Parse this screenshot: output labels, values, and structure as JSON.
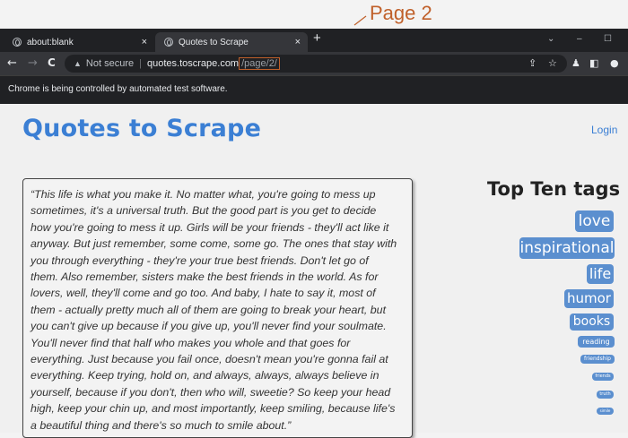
{
  "annotation": {
    "text": "Page 2",
    "color": "#c0602a"
  },
  "browser": {
    "tabs": [
      {
        "label": "about:blank",
        "close": "×"
      },
      {
        "label": "Quotes to Scrape",
        "close": "×"
      }
    ],
    "new_tab": "+",
    "window_controls": {
      "dropdown": "⌄",
      "minimize": "–",
      "maximize": "☐"
    },
    "nav": {
      "back": "←",
      "forward": "→",
      "reload": "C"
    },
    "omnibox": {
      "security_icon": "▲",
      "security_label": "Not secure",
      "domain": "quotes.toscrape.com",
      "path": "/page/2/"
    },
    "toolbar_icons": [
      "share-icon",
      "star-icon",
      "flask-icon",
      "sidebar-icon",
      "profile-icon"
    ],
    "infobar": "Chrome is being controlled by automated test software."
  },
  "site": {
    "title": "Quotes to Scrape",
    "login": "Login",
    "accent_color": "#3b7fd4",
    "tag_color": "#5b8fcf",
    "quote": {
      "lines": [
        "“This life is what you make it. No matter what, you're going to mess up",
        "sometimes, it's a universal truth. But the good part is you get to decide",
        "how you're going to mess it up. Girls will be your friends - they'll act like it",
        "anyway. But just remember, some come, some go. The ones that stay with",
        "you through everything - they're your true best friends. Don't let go of",
        "them. Also remember, sisters make the best friends in the world. As for",
        "lovers, well, they'll come and go too. And baby, I hate to say it, most of",
        "them - actually pretty much all of them are going to break your heart, but",
        "you can't give up because if you give up, you'll never find your soulmate.",
        "You'll never find that half who makes you whole and that goes for",
        "everything. Just because you fail once, doesn't mean you're gonna fail at",
        "everything. Keep trying, hold on, and always, always, always believe in",
        "yourself, because if you don't, then who will, sweetie? So keep your head",
        "high, keep your chin up, and most importantly, keep smiling, because life's",
        "a beautiful thing and there's so much to smile about.”"
      ]
    },
    "top_tags": {
      "title": "Top Ten tags",
      "tags": [
        "love",
        "inspirational",
        "life",
        "humor",
        "books",
        "reading",
        "friendship",
        "friends",
        "truth",
        "simile"
      ]
    }
  }
}
